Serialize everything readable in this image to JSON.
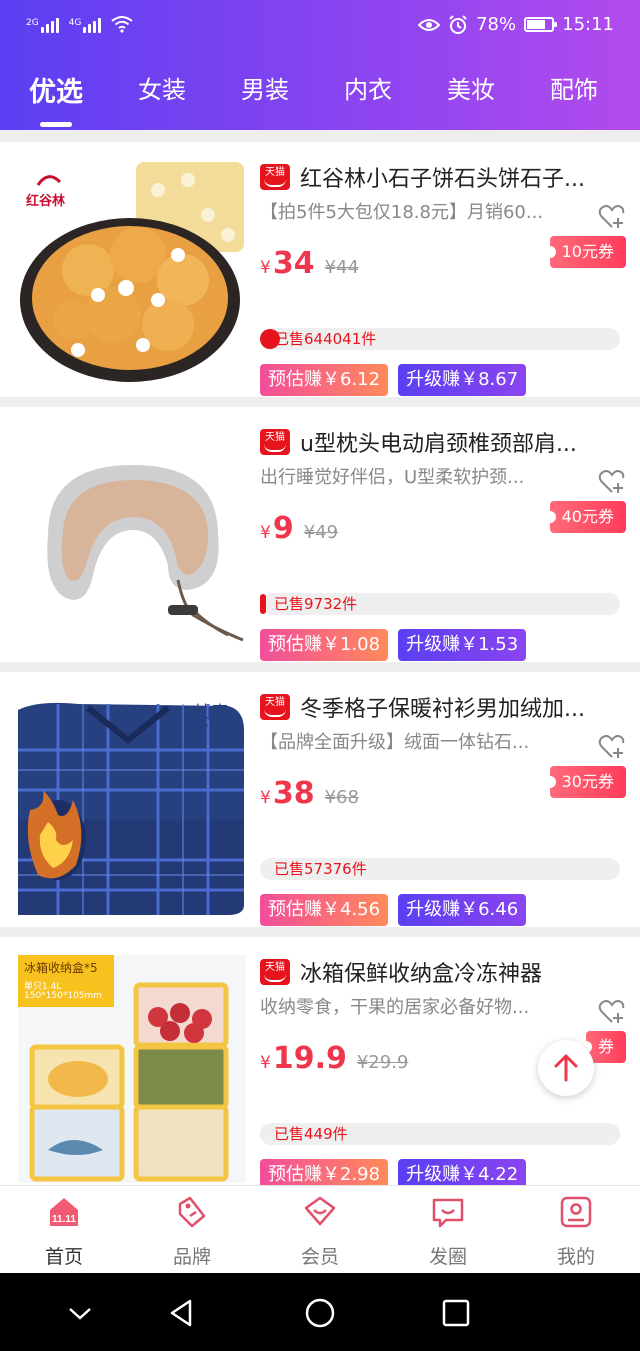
{
  "status_bar": {
    "signal1": "2G",
    "signal2": "4G",
    "battery": "78%",
    "time": "15:11"
  },
  "tabs": [
    {
      "label": "优选",
      "active": true
    },
    {
      "label": "女装"
    },
    {
      "label": "男装"
    },
    {
      "label": "内衣"
    },
    {
      "label": "美妆"
    },
    {
      "label": "配饰"
    }
  ],
  "products": [
    {
      "badge": "天猫",
      "title": "红谷林小石子饼石头饼石子...",
      "subtitle": "【拍5件5大包仅18.8元】月销60...",
      "currency": "¥",
      "price": "34",
      "original_price": "¥44",
      "coupon": "10元券",
      "sold": "已售644041件",
      "estimate": "预估赚￥6.12",
      "upgrade": "升级赚￥8.67",
      "image_brand": "红谷林"
    },
    {
      "badge": "天猫",
      "title": "u型枕头电动肩颈椎颈部肩...",
      "subtitle": "出行睡觉好伴侣，U型柔软护颈...",
      "currency": "¥",
      "price": "9",
      "original_price": "¥49",
      "coupon": "40元券",
      "sold": "已售9732件",
      "estimate": "预估赚￥1.08",
      "upgrade": "升级赚￥1.53"
    },
    {
      "badge": "天猫",
      "title": "冬季格子保暖衬衫男加绒加...",
      "subtitle": "【品牌全面升级】绒面一体钻石...",
      "currency": "¥",
      "price": "38",
      "original_price": "¥68",
      "coupon": "30元券",
      "sold": "已售57376件",
      "estimate": "预估赚￥4.56",
      "upgrade": "升级赚￥6.46",
      "image_brand": "灿鹿",
      "image_brand_en": "CANLU"
    },
    {
      "badge": "天猫",
      "title": "冰箱保鲜收纳盒冷冻神器",
      "subtitle": "收纳零食，干果的居家必备好物...",
      "currency": "¥",
      "price": "19.9",
      "original_price": "¥29.9",
      "coupon": "券",
      "sold": "已售449件",
      "estimate": "预估赚￥2.98",
      "upgrade": "升级赚￥4.22",
      "image_label": "冰箱收纳盒*5",
      "image_sub1": "单只1.4L",
      "image_sub2": "150*150*105mm"
    }
  ],
  "bottom_nav": [
    {
      "label": "首页",
      "icon": "home-1111-icon",
      "active": true
    },
    {
      "label": "品牌",
      "icon": "tag-icon"
    },
    {
      "label": "会员",
      "icon": "vip-diamond-icon"
    },
    {
      "label": "发圈",
      "icon": "chat-bubble-icon"
    },
    {
      "label": "我的",
      "icon": "profile-icon"
    }
  ],
  "colors": {
    "header_start": "#5b3ff2",
    "header_end": "#b24bee",
    "price": "#f0364c",
    "tmall_red": "#e8141d",
    "estimate_start": "#f24e9a",
    "upgrade_start": "#5b3ff2"
  }
}
